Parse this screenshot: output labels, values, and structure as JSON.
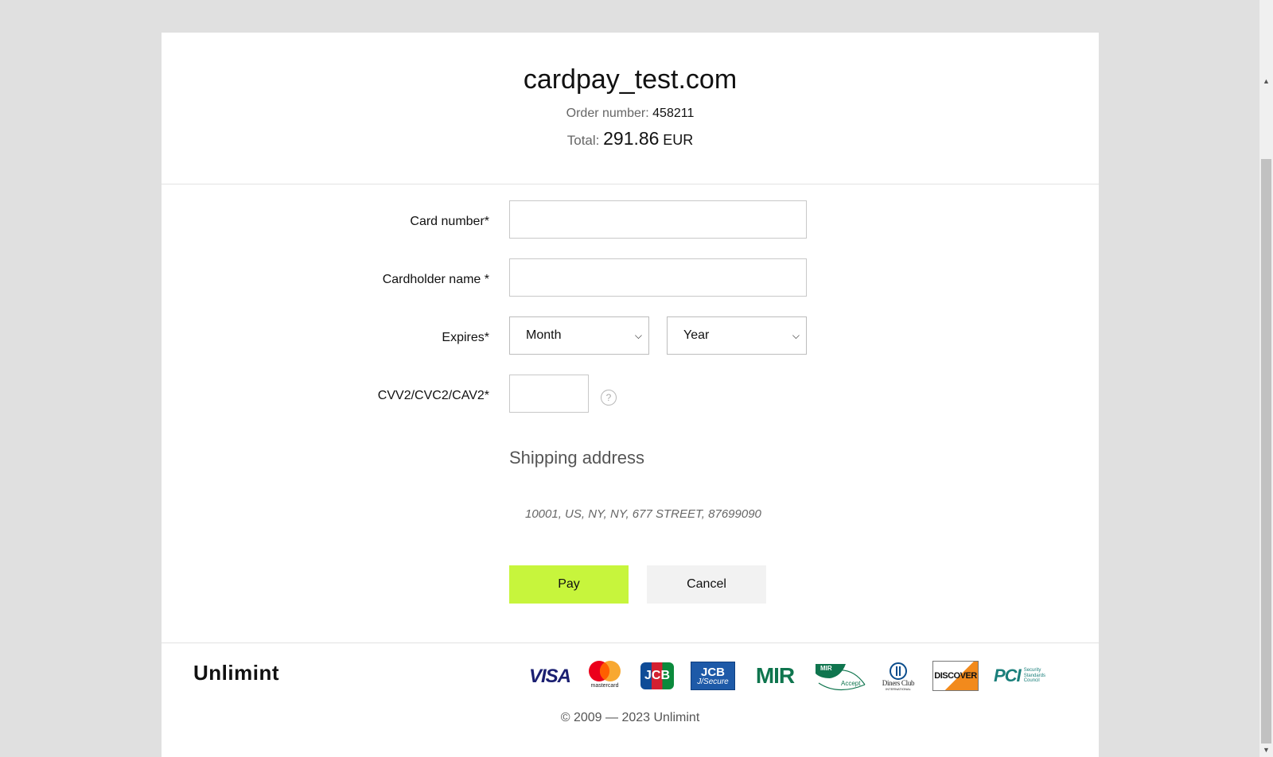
{
  "header": {
    "merchant": "cardpay_test.com",
    "order_label": "Order number:",
    "order_number": "458211",
    "total_label": "Total:",
    "total_amount": "291.86",
    "currency": "EUR"
  },
  "form": {
    "card_number_label": "Card number*",
    "card_number_value": "",
    "cardholder_label": "Cardholder name *",
    "cardholder_value": "",
    "expires_label": "Expires*",
    "month_selected": "Month",
    "year_selected": "Year",
    "cvv_label": "CVV2/CVC2/CAV2*",
    "cvv_value": "",
    "help_symbol": "?"
  },
  "shipping": {
    "title": "Shipping address",
    "address": "10001, US, NY, NY, 677 STREET, 87699090"
  },
  "actions": {
    "pay_label": "Pay",
    "cancel_label": "Cancel"
  },
  "footer": {
    "brand": "Unlimint",
    "copyright": "© 2009 — 2023 Unlimint",
    "logos": {
      "visa": "VISA",
      "mastercard": "mastercard",
      "jcb": "JCB",
      "jcb_secure_top": "JCB",
      "jcb_secure_bottom": "J/Secure",
      "mir": "MIR",
      "mir_accept": "Accept",
      "diners": "Diners Club",
      "diners_sub": "INTERNATIONAL",
      "discover": "DISCOVER",
      "pci": "PCI",
      "pci_sub": "Security Standards Council"
    }
  },
  "colors": {
    "pay_button": "#c7f53c",
    "cancel_button": "#f2f2f2",
    "page_background": "#e0e0e0"
  }
}
